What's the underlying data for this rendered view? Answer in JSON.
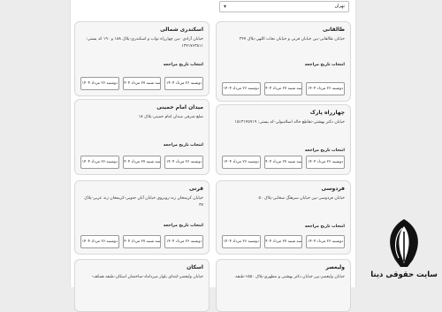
{
  "city_select": {
    "value": "تهران"
  },
  "cards": [
    {
      "name": "طالقانی",
      "address": "خیابان طالقانی-بین خیابان قرنی و خیابان نجات اللهی-پلاک ۲۴۷",
      "pick_label": "انتخاب تاریخ مراجعه",
      "dates": [
        "دوشنبه ۲۶ مرداد ۱۴۰۴",
        "سه شنبه ۲۷ مرداد ۱۴۰۴",
        "دوشنبه ۲۶ مرداد ۱۴۰۴"
      ]
    },
    {
      "name": "اسکندری شمالی",
      "address": "خیابان آزادی -بین چهارراه نواب و اسکندری-پلاک ۱۸۸ و ۱۹۰ کد پستی: ۱۳۴۱۷۶۳۸۱۱",
      "pick_label": "انتخاب تاریخ مراجعه",
      "dates": [
        "دوشنبه ۲۶ مرداد ۱۴۰۴",
        "سه شنبه ۲۷ مرداد ۱۴۰۴",
        "دوشنبه ۲۶ مرداد ۱۴۰۴"
      ]
    },
    {
      "name": "چهارراه پارک",
      "address": "خیابان دکتر بهشتی-تقاطع خالد اسلامبولی-کد پستی: ۱۵۱۳۱۴۵۹۱۹",
      "pick_label": "انتخاب تاریخ مراجعه",
      "dates": [
        "دوشنبه ۲۶ مرداد ۱۴۰۴",
        "سه شنبه ۲۷ مرداد ۱۴۰۴",
        "دوشنبه ۲۶ مرداد ۱۴۰۴"
      ]
    },
    {
      "name": "میدان امام خمینی",
      "address": "ضلع شرقی میدان امام خمینی-پلاک ۱۸",
      "pick_label": "انتخاب تاریخ مراجعه",
      "dates": [
        "دوشنبه ۲۶ مرداد ۱۴۰۴",
        "سه شنبه ۲۷ مرداد ۱۴۰۴",
        "دوشنبه ۲۶ مرداد ۱۴۰۴"
      ]
    },
    {
      "name": "فردوسی",
      "address": "خیابان فردوسی-بین خیابان سرهنگ سخایی-پلاک ۵۰",
      "pick_label": "انتخاب تاریخ مراجعه",
      "dates": [
        "دوشنبه ۲۶ مرداد ۱۴۰۴",
        "سه شنبه ۲۷ مرداد ۱۴۰۴",
        "دوشنبه ۲۶ مرداد ۱۴۰۴"
      ]
    },
    {
      "name": "قرنی",
      "address": "خیابان کریمخان زند-روبروی خیابان آبان جنوبی-کریمخان زند عربی-پلاک ۳۷",
      "pick_label": "انتخاب تاریخ مراجعه",
      "dates": [
        "دوشنبه ۲۶ مرداد ۱۴۰۴",
        "سه شنبه ۲۷ مرداد ۱۴۰۴",
        "دوشنبه ۲۶ مرداد ۱۴۰۴"
      ]
    },
    {
      "name": "ولیعصر",
      "address": "خیابان ولیعصر-بین خیابان دکتر بهشتی و مطهری-پلاک ۱۵۵۰-طبقه",
      "pick_label": "",
      "dates": []
    },
    {
      "name": "اسکان",
      "address": "خیابان ولیعصر-ابتدای بلوار میرداماد-ساختمان اسکان-طبقه همکف-",
      "pick_label": "",
      "dates": []
    }
  ],
  "logo": {
    "text": "سایت حقوقی دینا"
  }
}
